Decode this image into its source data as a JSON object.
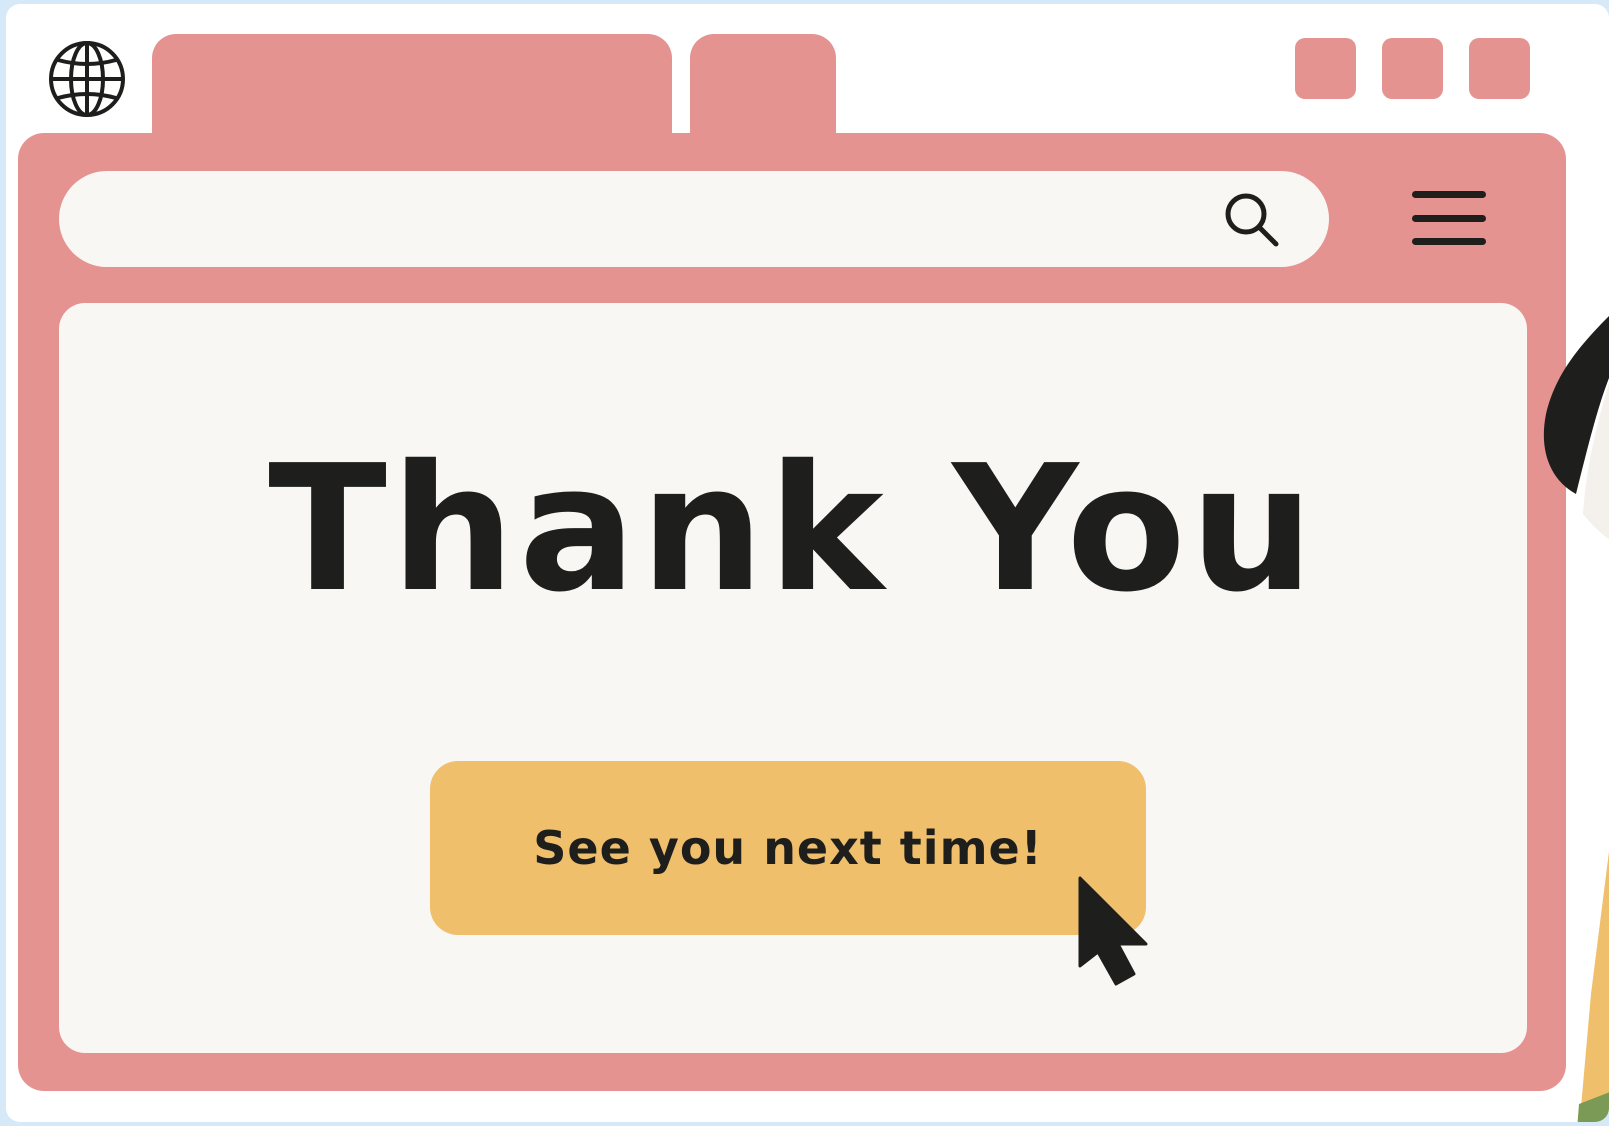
{
  "browser": {
    "tabs": [
      {
        "label": ""
      },
      {
        "label": ""
      }
    ],
    "address_bar": {
      "value": "",
      "placeholder": ""
    },
    "icons": {
      "site": "globe-icon",
      "search": "search-icon",
      "menu": "hamburger-menu-icon",
      "cursor": "cursor-arrow-icon"
    }
  },
  "main": {
    "heading": "Thank You",
    "cta_label": "See you next time!"
  },
  "colors": {
    "background": "#d6e9f8",
    "window": "#ffffff",
    "chrome": "#e49391",
    "content": "#f9f7f4",
    "button": "#efbf6c",
    "text": "#1e1e1c"
  }
}
